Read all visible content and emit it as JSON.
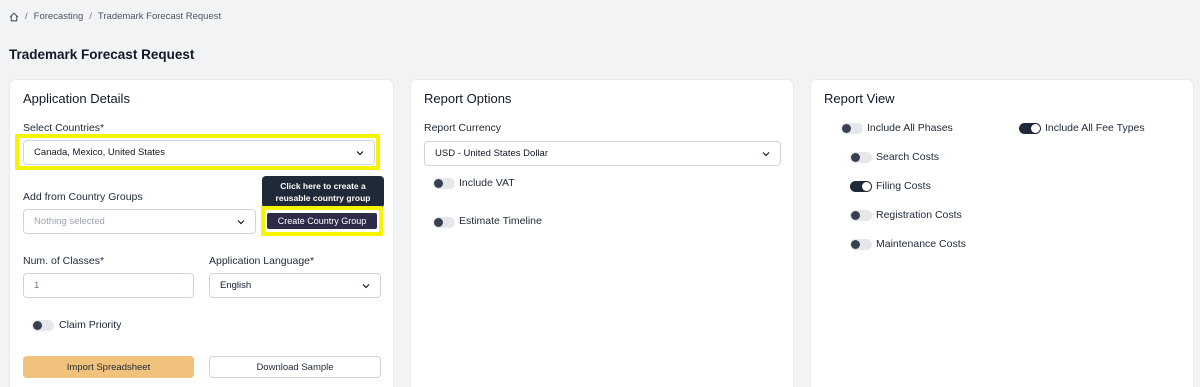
{
  "breadcrumb": {
    "items": [
      "Forecasting",
      "Trademark Forecast Request"
    ],
    "separator": "/"
  },
  "page": {
    "title": "Trademark Forecast Request"
  },
  "application_details": {
    "title": "Application Details",
    "countries": {
      "label": "Select Countries*",
      "value": "Canada, Mexico, United States"
    },
    "country_groups": {
      "label": "Add from Country Groups",
      "placeholder": "Nothing selected"
    },
    "tooltip": {
      "line1": "Click here to create a",
      "line2": "reusable country group"
    },
    "create_group_button": "Create Country Group",
    "num_classes": {
      "label": "Num. of Classes*",
      "value": "1"
    },
    "language": {
      "label": "Application Language*",
      "value": "English"
    },
    "claim_priority": {
      "label": "Claim Priority",
      "on": false
    },
    "import_button": "Import Spreadsheet",
    "download_button": "Download Sample"
  },
  "report_options": {
    "title": "Report Options",
    "currency": {
      "label": "Report Currency",
      "value": "USD - United States Dollar"
    },
    "include_vat": {
      "label": "Include VAT",
      "on": false
    },
    "estimate_timeline": {
      "label": "Estimate Timeline",
      "on": false
    }
  },
  "report_view": {
    "title": "Report View",
    "include_all_phases": {
      "label": "Include All Phases",
      "on": false
    },
    "include_all_fee_types": {
      "label": "Include All Fee Types",
      "on": true
    },
    "search_costs": {
      "label": "Search Costs",
      "on": false
    },
    "filing_costs": {
      "label": "Filing Costs",
      "on": true
    },
    "registration_costs": {
      "label": "Registration Costs",
      "on": false
    },
    "maintenance_costs": {
      "label": "Maintenance Costs",
      "on": false
    }
  },
  "colors": {
    "highlight": "#f6f500",
    "accent_button": "#2e2a4a",
    "import_button": "#f0c27b",
    "background": "#f2f3f5"
  },
  "icons": {
    "home": "home-icon",
    "dropdown": "chevron-down-icon"
  }
}
